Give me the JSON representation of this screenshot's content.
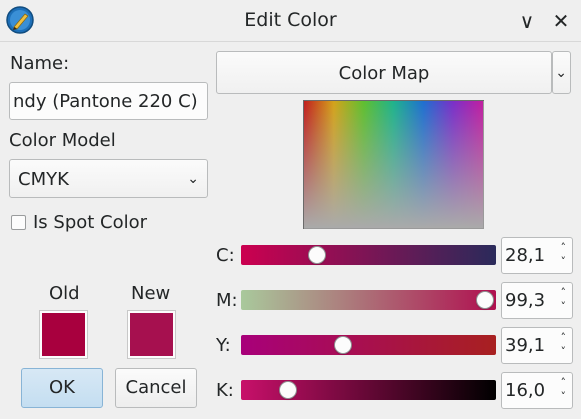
{
  "window": {
    "title": "Edit Color",
    "icons": {
      "app": "pen-app-icon",
      "minimize": "chevron-down-icon",
      "close": "close-icon"
    },
    "minimize_glyph": "∨",
    "close_glyph": "✕"
  },
  "name_section": {
    "label": "Name:",
    "value": "ndy (Pantone 220 C)"
  },
  "color_model": {
    "label": "Color Model",
    "selected": "CMYK"
  },
  "spot_color": {
    "label": "Is Spot Color",
    "checked": false
  },
  "swatches": {
    "old_label": "Old",
    "new_label": "New",
    "old_color": "#a8003e",
    "new_color": "#a6104f"
  },
  "buttons": {
    "ok": "OK",
    "cancel": "Cancel"
  },
  "view_selector": {
    "selected": "Color Map"
  },
  "sliders": [
    {
      "label": "C:",
      "value": "28,1",
      "fraction": 0.281
    },
    {
      "label": "M:",
      "value": "99,3",
      "fraction": 0.993
    },
    {
      "label": "Y:",
      "value": "39,1",
      "fraction": 0.391
    },
    {
      "label": "K:",
      "value": "16,0",
      "fraction": 0.16
    }
  ],
  "colors": {
    "accent": "#88b4d6",
    "c_track_start": "#cc0050",
    "c_track_end": "#2a2a5a",
    "m_track_start": "#a9c99c",
    "m_track_end": "#b01050",
    "y_track_start": "#a8007a",
    "y_track_end": "#a82020",
    "k_track_start": "#c8106a",
    "k_track_end": "#000000"
  }
}
